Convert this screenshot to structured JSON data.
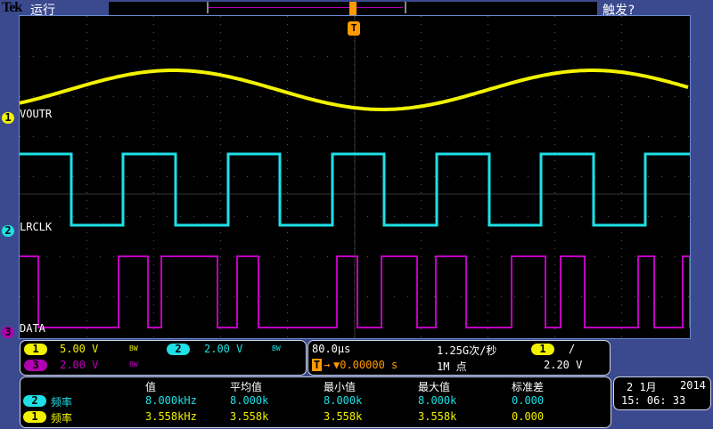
{
  "header": {
    "brand": "Tek",
    "status": "运行",
    "trigger_state": "触发?"
  },
  "channels": [
    {
      "id": "1",
      "name": "VOUTR",
      "scale": "5.00 V",
      "bw": "BW",
      "color": "#f2f200"
    },
    {
      "id": "2",
      "name": "LRCLK",
      "scale": "2.00 V",
      "bw": "BW",
      "color": "#1ee0e6"
    },
    {
      "id": "3",
      "name": "DATA",
      "scale": "2.00 V",
      "bw": "BW",
      "color": "#c000c0"
    }
  ],
  "timebase": {
    "scale": "80.0µs",
    "sample_rate": "1.25G次/秒",
    "record": "1M 点",
    "trigger_pos_icon": "T",
    "trigger_offset": "▼0.00000 s"
  },
  "trigger": {
    "source": "1",
    "slope": "/",
    "level": "2.20 V"
  },
  "measurements": {
    "headers": [
      "值",
      "平均值",
      "最小值",
      "最大值",
      "标准差"
    ],
    "rows": [
      {
        "ch": "2",
        "label": "频率",
        "values": [
          "8.000kHz",
          "8.000k",
          "8.000k",
          "8.000k",
          "0.000"
        ]
      },
      {
        "ch": "1",
        "label": "频率",
        "values": [
          "3.558kHz",
          "3.558k",
          "3.558k",
          "3.558k",
          "0.000"
        ]
      }
    ]
  },
  "datetime": {
    "date": "2 1月",
    "year": "2014",
    "time": "15: 06: 33"
  }
}
